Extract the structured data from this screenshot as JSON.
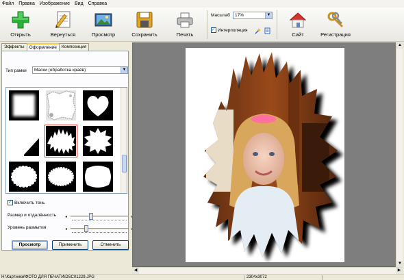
{
  "menu": [
    "Файл",
    "Правка",
    "Изображение",
    "Вид",
    "Справка"
  ],
  "toolbar": {
    "open": "Открыть",
    "back": "Вернуться",
    "preview": "Просмотр",
    "save": "Сохранить",
    "print": "Печать",
    "site": "Сайт",
    "register": "Регистрация",
    "scale_label": "Масштаб",
    "scale_value": "17%",
    "interp_label": "Интерполяция",
    "interp_checked": true
  },
  "left_panel": {
    "tabs": [
      "Эффекты",
      "Оформление",
      "Композиция"
    ],
    "active_tab": "Оформление",
    "frame_type_label": "Тип рамки",
    "frame_type_value": "Маски (обработка краёв)",
    "gallery_selected_index": 4,
    "shadow_label": "Включить тень",
    "shadow_checked": true,
    "size_label": "Размер и отдалённость",
    "size_level": 0.35,
    "blur_label": "Уровень размытия",
    "blur_level": 0.25,
    "buttons": {
      "preview": "Просмотр",
      "apply": "Применить",
      "cancel": "Отменить"
    }
  },
  "status": {
    "path": "H:\\Картинки\\ФОТО ДЛЯ ПЕЧАТИ\\DSC01229.JPG",
    "dimensions": "2304x3072"
  },
  "colors": {
    "accent_green": "#2bb13a",
    "selection_red": "#d33333",
    "preview_bg": "#7e7e7e",
    "tab_highlight": "#ffc83c"
  }
}
